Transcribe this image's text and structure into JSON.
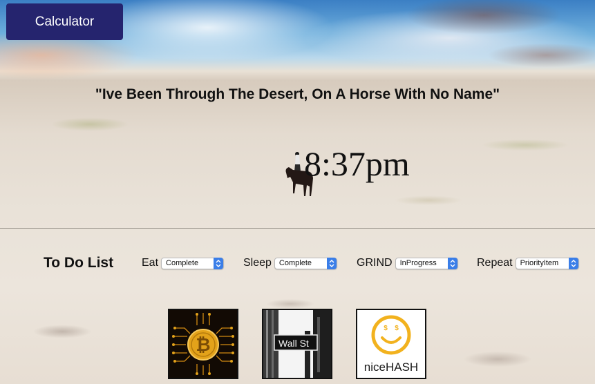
{
  "header": {
    "calculator_label": "Calculator"
  },
  "quote": "\"Ive Been Through The Desert, On A Horse With No Name\"",
  "clock": {
    "time": "8:37pm"
  },
  "todo": {
    "title": "To Do List",
    "items": [
      {
        "label": "Eat",
        "status": "Complete"
      },
      {
        "label": "Sleep",
        "status": "Complete"
      },
      {
        "label": "GRIND",
        "status": "InProgress"
      },
      {
        "label": "Repeat",
        "status": "PriorityItem"
      }
    ]
  },
  "links": {
    "nicehash_logo_text": "niceHASH",
    "wallst_sign_text": "Wall St"
  },
  "colors": {
    "button_bg": "#25246e",
    "select_arrow": "#3a7ee8",
    "bitcoin_gold": "#e3a21a",
    "nicehash_yellow": "#f2b21e"
  }
}
